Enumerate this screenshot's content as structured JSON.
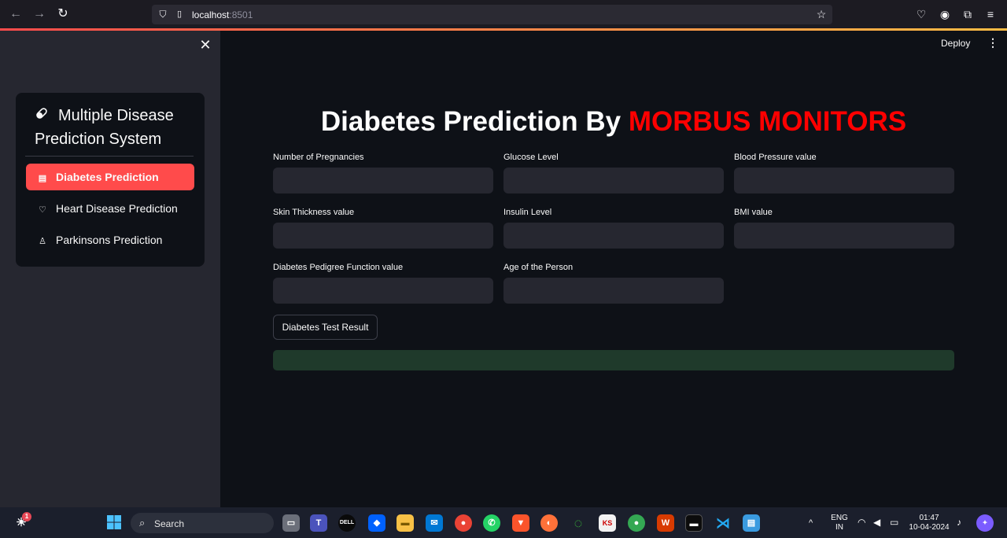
{
  "browser": {
    "url_host": "localhost",
    "url_port": ":8501"
  },
  "sidebar": {
    "title": "Multiple Disease Prediction System",
    "items": [
      {
        "label": "Diabetes Prediction",
        "active": true
      },
      {
        "label": "Heart Disease Prediction",
        "active": false
      },
      {
        "label": "Parkinsons Prediction",
        "active": false
      }
    ]
  },
  "header": {
    "deploy_label": "Deploy"
  },
  "main": {
    "title_prefix": "Diabetes Prediction By ",
    "title_brand": "MORBUS MONITORS",
    "fields": [
      {
        "label": "Number of Pregnancies",
        "value": ""
      },
      {
        "label": "Glucose Level",
        "value": ""
      },
      {
        "label": "Blood Pressure value",
        "value": ""
      },
      {
        "label": "Skin Thickness value",
        "value": ""
      },
      {
        "label": "Insulin Level",
        "value": ""
      },
      {
        "label": "BMI value",
        "value": ""
      },
      {
        "label": "Diabetes Pedigree Function value",
        "value": ""
      },
      {
        "label": "Age of the Person",
        "value": ""
      }
    ],
    "submit_label": "Diabetes Test Result",
    "result_text": ""
  },
  "taskbar": {
    "search_label": "Search",
    "notification_count": "1",
    "language": "ENG",
    "region": "IN",
    "time": "01:47",
    "date": "10-04-2024"
  },
  "colors": {
    "accent": "#ff4b4b",
    "brand_red": "#ff0000",
    "background": "#0e1117",
    "sidebar": "#262730",
    "success": "#1f3a2b"
  }
}
